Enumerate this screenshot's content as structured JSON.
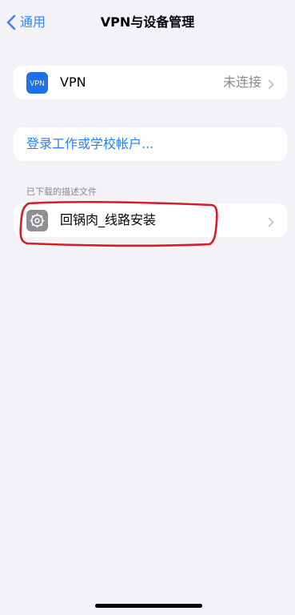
{
  "nav": {
    "back_label": "通用",
    "title": "VPN与设备管理"
  },
  "vpn": {
    "icon_text": "VPN",
    "label": "VPN",
    "status": "未连接"
  },
  "account": {
    "login_label": "登录工作或学校帐户..."
  },
  "profiles": {
    "header": "已下载的描述文件",
    "items": [
      {
        "label": "回锅肉_线路安装",
        "icon": "gear-icon"
      }
    ]
  },
  "colors": {
    "accent": "#3a82f6",
    "background": "#f2f2f7",
    "highlight": "#d21f2a"
  }
}
